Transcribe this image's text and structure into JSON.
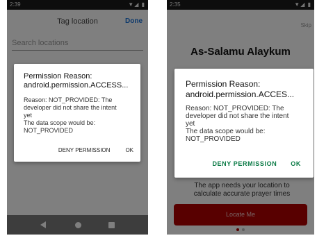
{
  "left_screen": {
    "status_time": "2:39",
    "status_icons": "▼◢ ▮",
    "title": "Tag location",
    "done_label": "Done",
    "search_placeholder": "Search locations",
    "dialog": {
      "title_line1": "Permission Reason:",
      "title_line2": "android.permission.ACCESS...",
      "message_lines": [
        "Reason: NOT_PROVIDED: The",
        "developer did not share the intent",
        "yet",
        " The data scope would be:",
        "NOT_PROVIDED"
      ],
      "deny_label": "DENY PERMISSION",
      "ok_label": "OK"
    }
  },
  "right_screen": {
    "status_time": "2:35",
    "status_icons": "▼◢ ▮",
    "skip_label": "Skip",
    "greeting": "As-Salamu Alaykum",
    "info_line1": "The app needs your location to",
    "info_line2": "calculate accurate prayer times",
    "locate_button_label": "Locate Me",
    "page_indicator": {
      "count": 2,
      "active": 0
    },
    "dialog": {
      "title_line1": "Permission Reason:",
      "title_line2": "android.permission.ACCES...",
      "message_lines": [
        "Reason: NOT_PROVIDED: The",
        "developer did not share the intent",
        "yet",
        " The data scope would be:",
        "NOT_PROVIDED"
      ],
      "deny_label": "DENY PERMISSION",
      "ok_label": "OK"
    }
  },
  "colors": {
    "accent_blue": "#1a73d9",
    "dialog_button_green": "#0a7a45",
    "locate_button_red": "#b00000",
    "dot_active": "#b00000",
    "dot_inactive": "#bdbdbd"
  }
}
